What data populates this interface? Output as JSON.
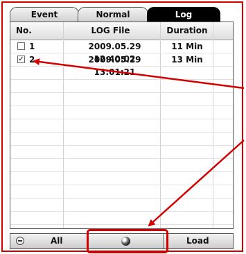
{
  "tabs": [
    {
      "label": "Event",
      "active": false
    },
    {
      "label": "Normal",
      "active": false
    },
    {
      "label": "Log",
      "active": true
    }
  ],
  "table": {
    "headers": [
      "No.",
      "LOG File",
      "Duration"
    ],
    "rows": [
      {
        "no": "1",
        "file": "2009.05.29 12:40:02",
        "duration": "11 Min",
        "checked": false
      },
      {
        "no": "2",
        "file": "2009.05.29 13:01:21",
        "duration": "13 Min",
        "checked": true
      }
    ]
  },
  "toolbar": {
    "all_label": "All",
    "load_label": "Load",
    "middle_icon": "globe-icon"
  },
  "annotation": {
    "color": "#d40000"
  }
}
